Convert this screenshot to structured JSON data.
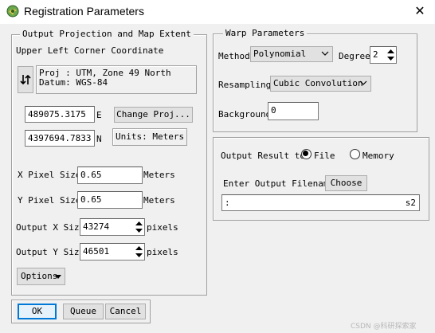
{
  "window": {
    "title": "Registration Parameters",
    "close_glyph": "✕",
    "icon": "envi-app-icon"
  },
  "projection_group": {
    "legend": "Output Projection and Map Extent",
    "upper_left_label": "Upper Left Corner Coordinate",
    "proj_line1": "Proj : UTM, Zone 49 North",
    "proj_line2": "Datum: WGS-84",
    "swap_icon": "swap-arrows-icon",
    "x_coord": "489075.3175",
    "x_suffix": "E",
    "y_coord": "4397694.7833",
    "y_suffix": "N",
    "change_proj_label": "Change Proj...",
    "units_label": "Units: Meters",
    "x_pixel_label": "X Pixel Size",
    "x_pixel_value": "0.65",
    "x_pixel_units": "Meters",
    "y_pixel_label": "Y Pixel Size",
    "y_pixel_value": "0.65",
    "y_pixel_units": "Meters",
    "out_x_label": "Output X Size",
    "out_x_value": "43274",
    "out_x_units": "pixels",
    "out_y_label": "Output Y Size",
    "out_y_value": "46501",
    "out_y_units": "pixels",
    "options_label": "Options"
  },
  "warp_group": {
    "legend": "Warp Parameters",
    "method_label": "Method",
    "method_value": "Polynomial",
    "degree_label": "Degree",
    "degree_value": "2",
    "resampling_label": "Resampling",
    "resampling_value": "Cubic Convolution",
    "background_label": "Background",
    "background_value": "0"
  },
  "output_group": {
    "output_result_label": "Output Result to",
    "file_label": "File",
    "memory_label": "Memory",
    "selected": "File",
    "filename_label": "Enter Output Filename",
    "choose_label": "Choose",
    "filename_value_left": ":",
    "filename_value_right": "s2"
  },
  "footer": {
    "ok_label": "OK",
    "queue_label": "Queue",
    "cancel_label": "Cancel"
  },
  "watermark": "CSDN @科研探索家"
}
